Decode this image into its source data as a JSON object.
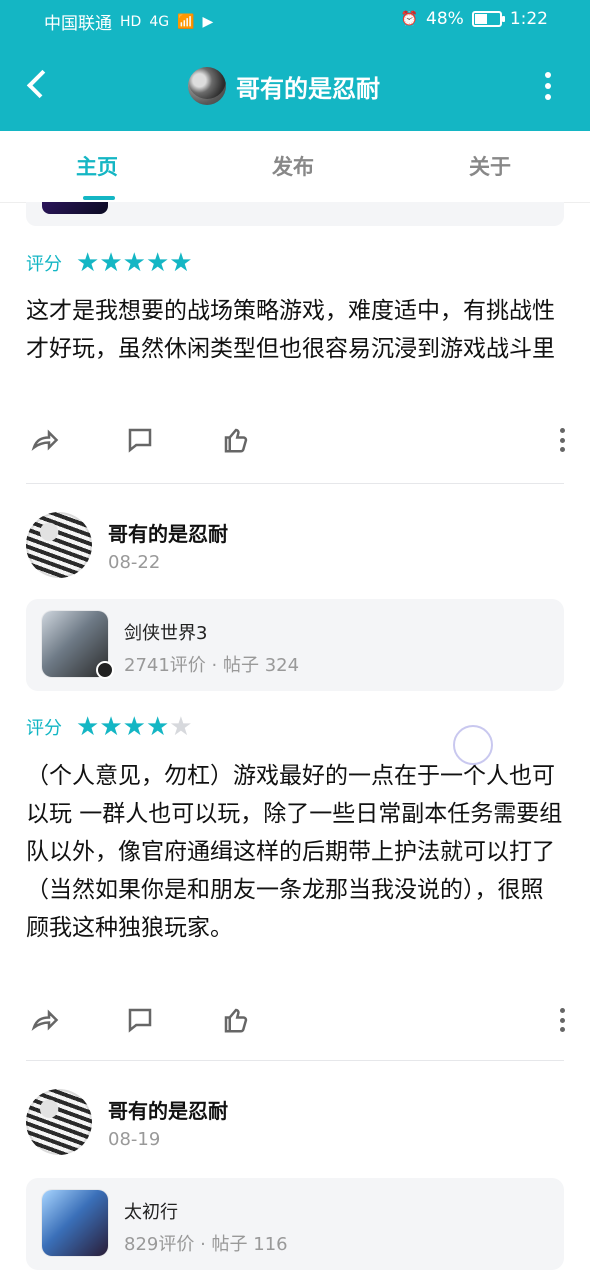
{
  "status_bar": {
    "carrier": "中国联通",
    "hd": "HD",
    "signal": "4G",
    "battery": "48%",
    "battery_level": 0.48,
    "time": "1:22"
  },
  "header": {
    "title": "哥有的是忍耐"
  },
  "tabs": [
    {
      "label": "主页",
      "active": true
    },
    {
      "label": "发布",
      "active": false
    },
    {
      "label": "关于",
      "active": false
    }
  ],
  "posts": [
    {
      "rating_label": "评分",
      "stars": 5,
      "text": "这才是我想要的战场策略游戏，难度适中，有挑战性才好玩，虽然休闲类型但也很容易沉浸到游戏战斗里"
    },
    {
      "user": {
        "name": "哥有的是忍耐",
        "date": "08-22"
      },
      "game": {
        "name": "剑侠世界3",
        "meta": "2741评价 · 帖子 324"
      },
      "rating_label": "评分",
      "stars": 4,
      "text": "（个人意见，勿杠）游戏最好的一点在于一个人也可以玩 一群人也可以玩，除了一些日常副本任务需要组队以外，像官府通缉这样的后期带上护法就可以打了（当然如果你是和朋友一条龙那当我没说的），很照顾我这种独狼玩家。"
    },
    {
      "user": {
        "name": "哥有的是忍耐",
        "date": "08-19"
      },
      "game": {
        "name": "太初行",
        "meta": "829评价 · 帖子 116"
      }
    }
  ],
  "colors": {
    "accent": "#14B6C4",
    "star_off": "#d7d9dd"
  },
  "icons": [
    "back-icon",
    "more-vert-icon",
    "star-icon",
    "share-icon",
    "comment-icon",
    "like-icon",
    "kebab-icon"
  ]
}
